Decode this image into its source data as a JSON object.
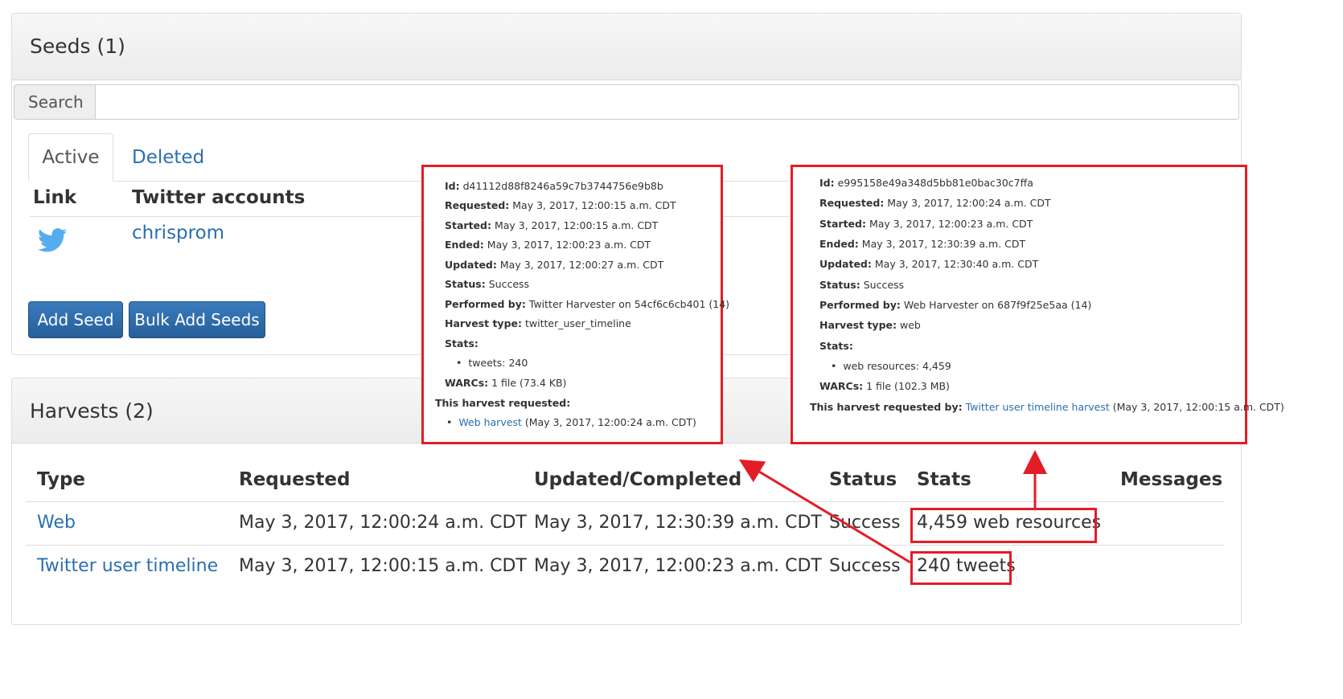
{
  "seeds_panel": {
    "title": "Seeds (1)",
    "search": {
      "label": "Search",
      "value": "",
      "placeholder": ""
    },
    "tabs": [
      {
        "label": "Active"
      },
      {
        "label": "Deleted"
      }
    ],
    "columns": {
      "link": "Link",
      "accounts": "Twitter accounts"
    },
    "rows": [
      {
        "icon": "twitter-bird-icon",
        "account": "chrisprom"
      }
    ],
    "buttons": {
      "add_seed": "Add Seed",
      "bulk_add": "Bulk Add Seeds"
    }
  },
  "harvests_panel": {
    "title": "Harvests (2)",
    "columns": {
      "type": "Type",
      "requested": "Requested",
      "updated": "Updated/Completed",
      "status": "Status",
      "stats": "Stats",
      "messages": "Messages"
    },
    "rows": [
      {
        "type": "Web",
        "requested": "May 3, 2017, 12:00:24 a.m. CDT",
        "updated": "May 3, 2017, 12:30:39 a.m. CDT",
        "status": "Success",
        "stats": "4,459 web resources",
        "messages": ""
      },
      {
        "type": "Twitter user timeline",
        "requested": "May 3, 2017, 12:00:15 a.m. CDT",
        "updated": "May 3, 2017, 12:00:23 a.m. CDT",
        "status": "Success",
        "stats": "240 tweets",
        "messages": ""
      }
    ]
  },
  "callout_twitter": {
    "id_label": "Id:",
    "id": "d41112d88f8246a59c7b3744756e9b8b",
    "requested_label": "Requested:",
    "requested": "May 3, 2017, 12:00:15 a.m. CDT",
    "started_label": "Started:",
    "started": "May 3, 2017, 12:00:15 a.m. CDT",
    "ended_label": "Ended:",
    "ended": "May 3, 2017, 12:00:23 a.m. CDT",
    "updated_label": "Updated:",
    "updated": "May 3, 2017, 12:00:27 a.m. CDT",
    "status_label": "Status:",
    "status": "Success",
    "performed_label": "Performed by:",
    "performed": "Twitter Harvester on 54cf6c6cb401 (14)",
    "type_label": "Harvest type:",
    "type": "twitter_user_timeline",
    "stats_label": "Stats:",
    "stats_item": "tweets: 240",
    "warcs_label": "WARCs:",
    "warcs": "1 file (73.4 KB)",
    "requested_heading": "This harvest requested:",
    "requested_link": "Web harvest",
    "requested_link_date": "(May 3, 2017, 12:00:24 a.m. CDT)"
  },
  "callout_web": {
    "id_label": "Id:",
    "id": "e995158e49a348d5bb81e0bac30c7ffa",
    "requested_label": "Requested:",
    "requested": "May 3, 2017, 12:00:24 a.m. CDT",
    "started_label": "Started:",
    "started": "May 3, 2017, 12:00:23 a.m. CDT",
    "ended_label": "Ended:",
    "ended": "May 3, 2017, 12:30:39 a.m. CDT",
    "updated_label": "Updated:",
    "updated": "May 3, 2017, 12:30:40 a.m. CDT",
    "status_label": "Status:",
    "status": "Success",
    "performed_label": "Performed by:",
    "performed": "Web Harvester on 687f9f25e5aa (14)",
    "type_label": "Harvest type:",
    "type": "web",
    "stats_label": "Stats:",
    "stats_item": "web resources: 4,459",
    "warcs_label": "WARCs:",
    "warcs": "1 file (102.3 MB)",
    "requested_by_label": "This harvest requested by:",
    "requested_by_link": "Twitter user timeline harvest",
    "requested_by_date": "(May 3, 2017, 12:00:15 a.m. CDT)"
  },
  "colors": {
    "link": "#2a6fb0",
    "button": "#2f6da8",
    "annotation": "#e21d26",
    "twitter": "#55acee"
  }
}
